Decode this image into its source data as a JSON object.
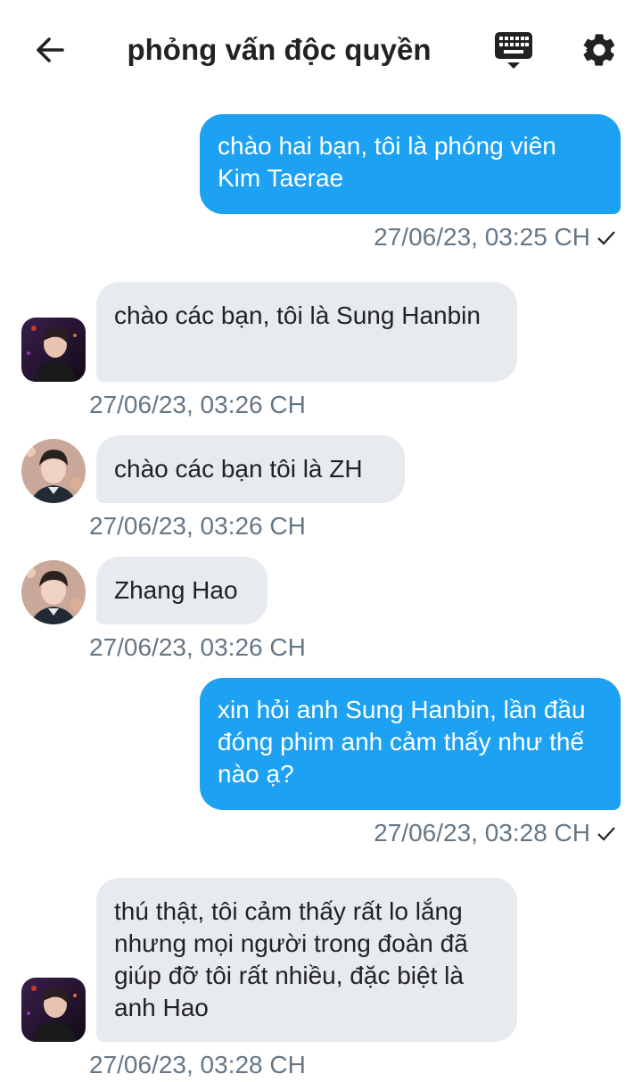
{
  "header": {
    "title": "phỏng vấn độc quyền",
    "back_icon": "arrow-left-icon",
    "keyboard_icon": "keyboard-icon",
    "settings_icon": "gear-icon"
  },
  "messages": [
    {
      "side": "out",
      "text": "chào hai bạn, tôi là phóng viên Kim Taerae",
      "time": "27/06/23, 03:25 CH"
    },
    {
      "side": "in",
      "avatar": "avatar-sung-hanbin",
      "text": "chào các bạn, tôi là Sung Hanbin",
      "time": "27/06/23, 03:26 CH"
    },
    {
      "side": "in",
      "avatar": "avatar-zhang-hao",
      "text": "chào các bạn tôi là ZH",
      "time": "27/06/23, 03:26 CH"
    },
    {
      "side": "in",
      "avatar": "avatar-zhang-hao",
      "text": "Zhang Hao",
      "time": "27/06/23, 03:26 CH"
    },
    {
      "side": "out",
      "text": "xin hỏi anh Sung Hanbin, lần đầu đóng phim anh cảm thấy như thế nào ạ?",
      "time": "27/06/23, 03:28 CH"
    },
    {
      "side": "in",
      "avatar": "avatar-sung-hanbin",
      "text": "thú thật, tôi cảm thấy rất lo lắng nhưng mọi người trong đoàn đã giúp đỡ tôi rất nhiều, đặc biệt là anh Hao",
      "time": "27/06/23, 03:28 CH"
    }
  ],
  "colors": {
    "outgoing_bubble": "#1da1f2",
    "incoming_bubble": "#e7ebef",
    "timestamp": "#657786"
  }
}
